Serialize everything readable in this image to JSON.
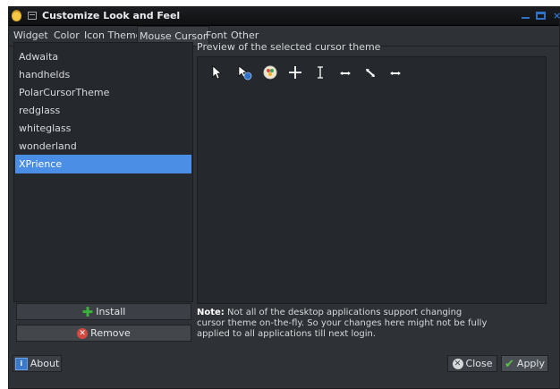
{
  "window": {
    "title": "Customize Look and Feel"
  },
  "tabs": [
    {
      "label": "Widget"
    },
    {
      "label": "Color"
    },
    {
      "label": "Icon Theme"
    },
    {
      "label": "Mouse Cursor",
      "active": true
    },
    {
      "label": "Font"
    },
    {
      "label": "Other"
    }
  ],
  "cursor_themes": {
    "items": [
      {
        "label": "Adwaita"
      },
      {
        "label": "handhelds"
      },
      {
        "label": "PolarCursorTheme"
      },
      {
        "label": "redglass"
      },
      {
        "label": "whiteglass"
      },
      {
        "label": "wonderland"
      },
      {
        "label": "XPrience",
        "selected": true
      }
    ]
  },
  "preview": {
    "label": "Preview of the selected cursor theme",
    "cursors": [
      "arrow-cursor-icon",
      "busy-arrow-cursor-icon",
      "watch-cursor-icon",
      "crosshair-cursor-icon",
      "text-cursor-icon",
      "horizontal-resize-cursor-icon",
      "diagonal-resize-cursor-icon",
      "horizontal-resize-cursor-icon"
    ]
  },
  "buttons": {
    "install": "Install",
    "remove": "Remove",
    "about": "About",
    "close": "Close",
    "apply": "Apply"
  },
  "note": {
    "bold": "Note:",
    "text": " Not all of the desktop applications support changing cursor theme on-the-fly. So your changes here might not be fully applied to all applications till next login."
  },
  "colors": {
    "accent": "#4a8ee6",
    "window_bg": "#2e3135",
    "panel_bg": "#25282c"
  }
}
